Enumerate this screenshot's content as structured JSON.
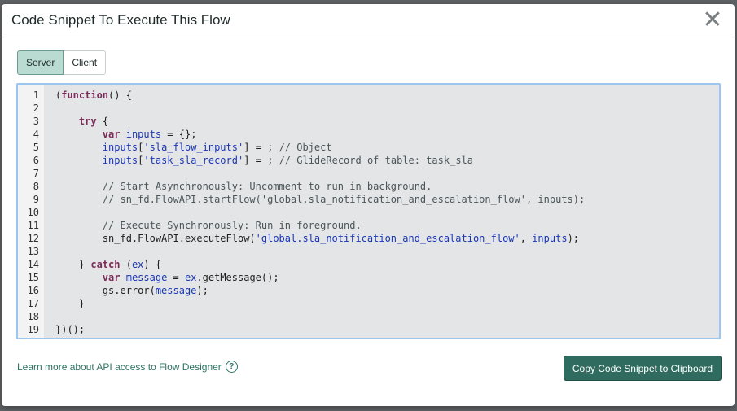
{
  "modal": {
    "title": "Code Snippet To Execute This Flow",
    "close_icon": "close-icon"
  },
  "tabs": [
    {
      "label": "Server",
      "active": true
    },
    {
      "label": "Client",
      "active": false
    }
  ],
  "code": {
    "line_numbers": [
      "1",
      "2",
      "3",
      "4",
      "5",
      "6",
      "7",
      "8",
      "9",
      "10",
      "11",
      "12",
      "13",
      "14",
      "15",
      "16",
      "17",
      "18",
      "19"
    ],
    "lines": [
      [
        {
          "t": "("
        },
        {
          "t": "function",
          "c": "kw"
        },
        {
          "t": "() {"
        }
      ],
      [],
      [
        {
          "t": "    "
        },
        {
          "t": "try",
          "c": "kw"
        },
        {
          "t": " {"
        }
      ],
      [
        {
          "t": "        "
        },
        {
          "t": "var",
          "c": "kw"
        },
        {
          "t": " "
        },
        {
          "t": "inputs",
          "c": "vr"
        },
        {
          "t": " = {};"
        }
      ],
      [
        {
          "t": "        "
        },
        {
          "t": "inputs",
          "c": "vr"
        },
        {
          "t": "["
        },
        {
          "t": "'sla_flow_inputs'",
          "c": "st"
        },
        {
          "t": "] = ; "
        },
        {
          "t": "// Object",
          "c": "cm"
        }
      ],
      [
        {
          "t": "        "
        },
        {
          "t": "inputs",
          "c": "vr"
        },
        {
          "t": "["
        },
        {
          "t": "'task_sla_record'",
          "c": "st"
        },
        {
          "t": "] = ; "
        },
        {
          "t": "// GlideRecord of table: task_sla",
          "c": "cm"
        }
      ],
      [],
      [
        {
          "t": "        "
        },
        {
          "t": "// Start Asynchronously: Uncomment to run in background.",
          "c": "cm"
        }
      ],
      [
        {
          "t": "        "
        },
        {
          "t": "// sn_fd.FlowAPI.startFlow('global.sla_notification_and_escalation_flow', inputs);",
          "c": "cm"
        }
      ],
      [],
      [
        {
          "t": "        "
        },
        {
          "t": "// Execute Synchronously: Run in foreground.",
          "c": "cm"
        }
      ],
      [
        {
          "t": "        sn_fd.FlowAPI.executeFlow("
        },
        {
          "t": "'global.sla_notification_and_escalation_flow'",
          "c": "st"
        },
        {
          "t": ", "
        },
        {
          "t": "inputs",
          "c": "vr"
        },
        {
          "t": ");"
        }
      ],
      [],
      [
        {
          "t": "    } "
        },
        {
          "t": "catch",
          "c": "kw"
        },
        {
          "t": " ("
        },
        {
          "t": "ex",
          "c": "vr"
        },
        {
          "t": ") {"
        }
      ],
      [
        {
          "t": "        "
        },
        {
          "t": "var",
          "c": "kw"
        },
        {
          "t": " "
        },
        {
          "t": "message",
          "c": "vr"
        },
        {
          "t": " = "
        },
        {
          "t": "ex",
          "c": "vr"
        },
        {
          "t": ".getMessage();"
        }
      ],
      [
        {
          "t": "        gs.error("
        },
        {
          "t": "message",
          "c": "vr"
        },
        {
          "t": ");"
        }
      ],
      [
        {
          "t": "    }"
        }
      ],
      [],
      [
        {
          "t": "})();"
        }
      ]
    ]
  },
  "footer": {
    "learn_more_link": "Learn more about API access to Flow Designer",
    "help_icon_glyph": "?",
    "copy_button": "Copy Code Snippet to Clipboard"
  },
  "colors": {
    "accent": "#2f6b5e",
    "tab_active_bg": "#b9dbd2",
    "code_focus_border": "#9cc5ef",
    "code_bg": "#e4e5e6",
    "keyword": "#7a2c58",
    "identifier": "#1a37b5",
    "comment": "#4a555a"
  }
}
